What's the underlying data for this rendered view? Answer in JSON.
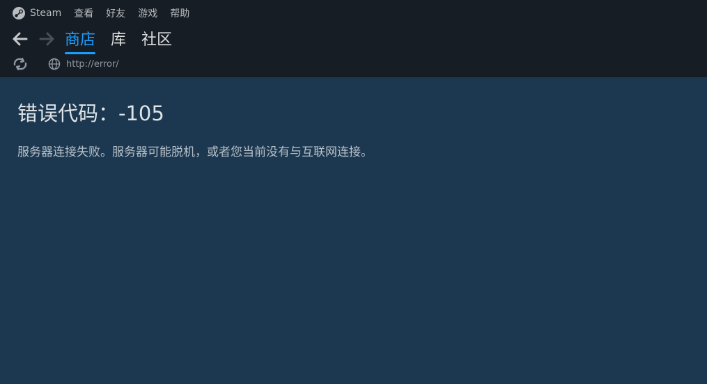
{
  "menubar": {
    "app_name": "Steam",
    "items": [
      "查看",
      "好友",
      "游戏",
      "帮助"
    ]
  },
  "nav": {
    "tabs": [
      {
        "label": "商店",
        "active": true
      },
      {
        "label": "库",
        "active": false
      },
      {
        "label": "社区",
        "active": false
      }
    ]
  },
  "address": {
    "url": "http://error/"
  },
  "error": {
    "title": "错误代码：-105",
    "message": "服务器连接失败。服务器可能脱机，或者您当前没有与互联网连接。"
  },
  "colors": {
    "active_tab": "#1a9fff",
    "background": "#1c3850",
    "header": "#171d25"
  },
  "icons": {
    "back": "arrow-left-icon",
    "forward": "arrow-right-icon",
    "reload": "reload-icon",
    "globe": "globe-icon",
    "steam": "steam-logo-icon"
  }
}
